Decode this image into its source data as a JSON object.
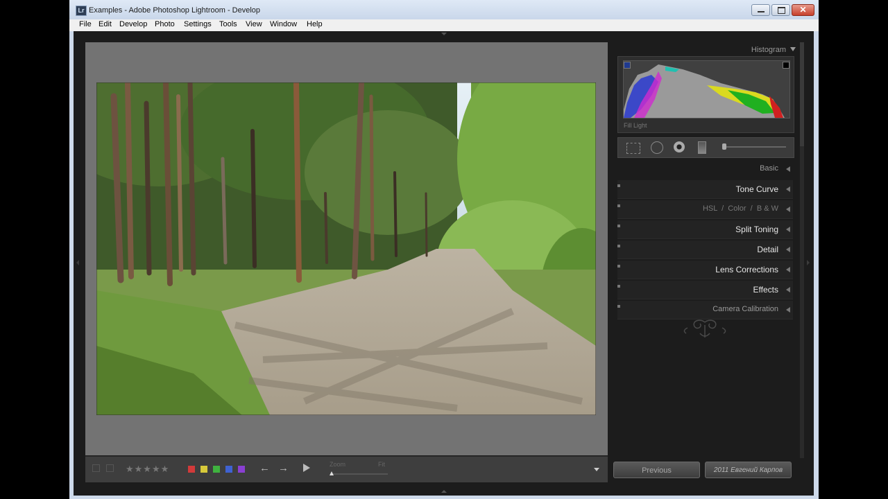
{
  "window": {
    "title": "Examples - Adobe Photoshop Lightroom - Develop",
    "app_icon": "Lr"
  },
  "menu": [
    "File",
    "Edit",
    "Develop",
    "Photo",
    "Settings",
    "Tools",
    "View",
    "Window",
    "Help"
  ],
  "histogram": {
    "title": "Histogram",
    "info_label": "Fill Light"
  },
  "sections": [
    {
      "label": "Basic"
    },
    {
      "label": "Tone Curve"
    },
    {
      "label": "HSL  /  Color  /  B & W"
    },
    {
      "label": "Split Toning"
    },
    {
      "label": "Detail"
    },
    {
      "label": "Lens Corrections"
    },
    {
      "label": "Effects"
    },
    {
      "label": "Camera Calibration"
    }
  ],
  "toolbar": {
    "stars": "★★★★★",
    "zoom_label": "Zoom",
    "zoom_value": "Fit",
    "color_labels": [
      "#d23a3a",
      "#d7c93a",
      "#3fb23f",
      "#3f62d2",
      "#8a3fd2"
    ],
    "prev_arrow": "←",
    "next_arrow": "→"
  },
  "buttons": {
    "previous": "Previous",
    "reset": "2011 Евгений Карпов"
  },
  "photo": {
    "subject": "forest dirt road"
  }
}
